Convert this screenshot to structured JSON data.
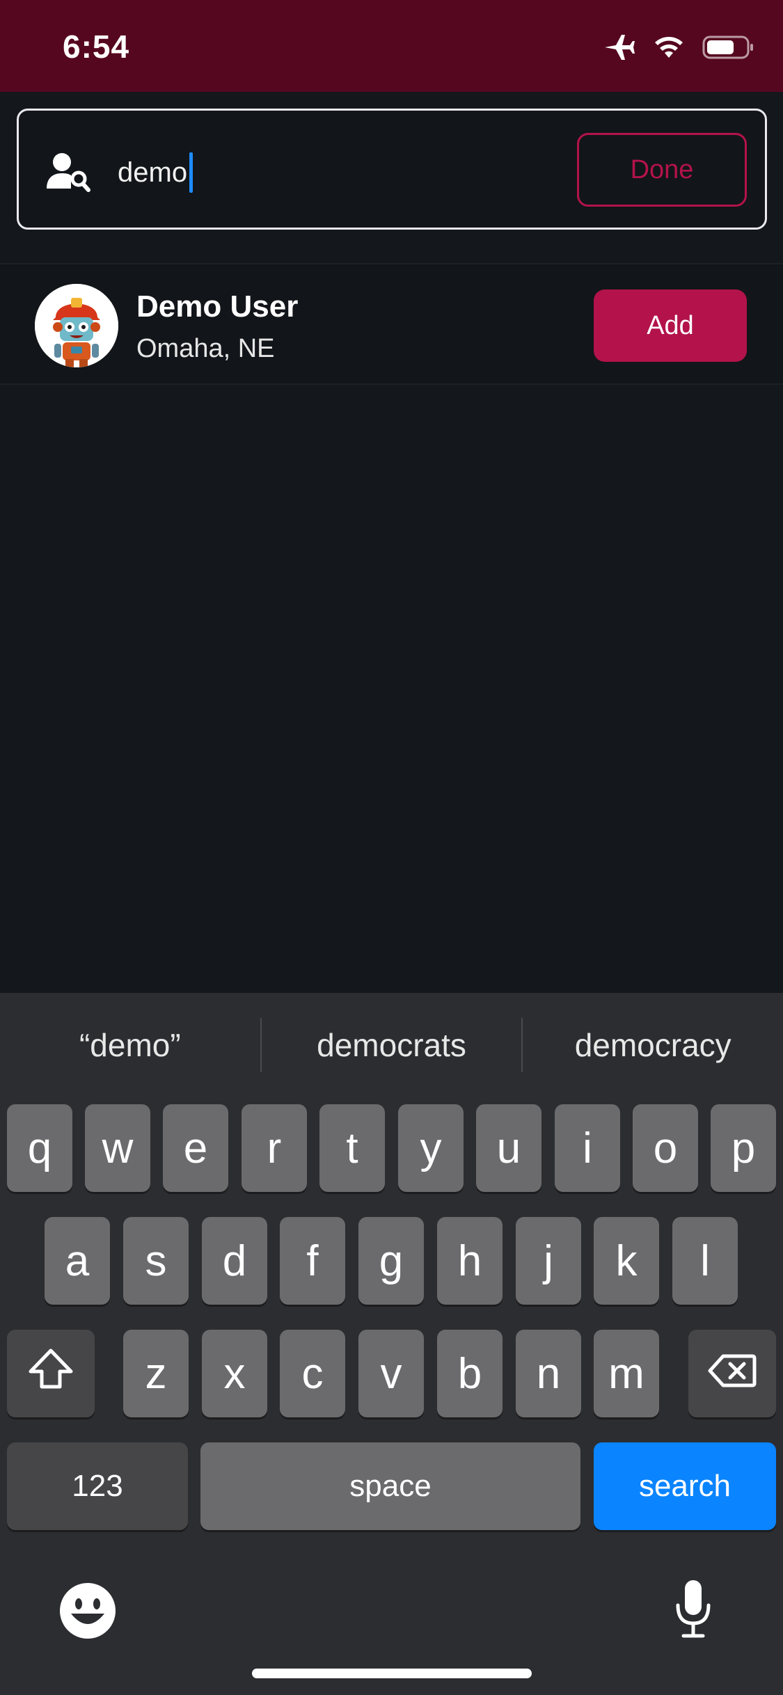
{
  "status_bar": {
    "time": "6:54",
    "icons": [
      "airplane-icon",
      "wifi-icon",
      "battery-icon"
    ],
    "background": "#560720"
  },
  "search": {
    "value": "demo",
    "icon": "user-search-icon",
    "done_label": "Done",
    "accent": "#b3134a"
  },
  "results": [
    {
      "name": "Demo User",
      "location": "Omaha, NE",
      "add_label": "Add",
      "avatar": "robot-firefighter-avatar"
    }
  ],
  "keyboard": {
    "suggestions": [
      "“demo”",
      "democrats",
      "democracy"
    ],
    "row1": [
      "q",
      "w",
      "e",
      "r",
      "t",
      "y",
      "u",
      "i",
      "o",
      "p"
    ],
    "row2": [
      "a",
      "s",
      "d",
      "f",
      "g",
      "h",
      "j",
      "k",
      "l"
    ],
    "row3": [
      "z",
      "x",
      "c",
      "v",
      "b",
      "n",
      "m"
    ],
    "numbers_label": "123",
    "space_label": "space",
    "search_label": "search",
    "icons": [
      "shift-icon",
      "backspace-icon",
      "emoji-icon",
      "microphone-icon"
    ],
    "search_key_color": "#0a84ff"
  }
}
